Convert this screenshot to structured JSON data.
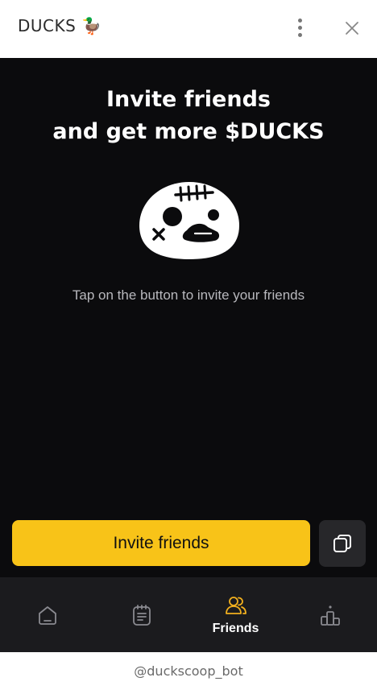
{
  "header": {
    "title": "DUCKS 🦆",
    "menu_icon": "more-vertical-icon",
    "close_icon": "close-icon"
  },
  "main": {
    "headline_line1": "Invite friends",
    "headline_line2": "and get more $DUCKS",
    "mascot_icon": "zombie-duck-icon",
    "subtitle": "Tap on the button to invite your friends",
    "invite_button_label": "Invite friends",
    "copy_icon": "copy-icon"
  },
  "bottom_nav": {
    "items": [
      {
        "icon": "home-icon",
        "label": ""
      },
      {
        "icon": "tasks-icon",
        "label": ""
      },
      {
        "icon": "friends-icon",
        "label": "Friends",
        "active": true
      },
      {
        "icon": "leaderboard-icon",
        "label": ""
      }
    ]
  },
  "footer": {
    "bot_handle": "@duckscoop_bot"
  },
  "colors": {
    "accent": "#f8c318",
    "background": "#0b0b0d",
    "nav_background": "#1b1b1e",
    "copy_button": "#27272a",
    "active_icon": "#f2b01e",
    "inactive_icon": "#8a8a90"
  }
}
